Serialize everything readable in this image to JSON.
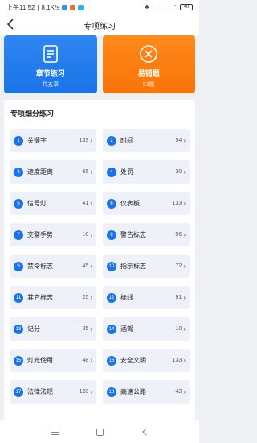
{
  "status_bar": {
    "time": "上午11:52",
    "speed": "8.1K/s",
    "battery": "40"
  },
  "header": {
    "title": "专项练习"
  },
  "cards": [
    {
      "title": "章节练习",
      "sub": "共五章",
      "color": "#1a74e8"
    },
    {
      "title": "易错题",
      "sub": "53题",
      "color": "#f97308"
    }
  ],
  "section": {
    "title": "专项细分练习"
  },
  "items": [
    {
      "num": "1",
      "label": "关键字",
      "count": "133"
    },
    {
      "num": "2",
      "label": "时间",
      "count": "54"
    },
    {
      "num": "3",
      "label": "速度距离",
      "count": "65"
    },
    {
      "num": "4",
      "label": "处罚",
      "count": "30"
    },
    {
      "num": "5",
      "label": "信号灯",
      "count": "41"
    },
    {
      "num": "6",
      "label": "仪表板",
      "count": "133"
    },
    {
      "num": "7",
      "label": "交警手势",
      "count": "10"
    },
    {
      "num": "8",
      "label": "警告标志",
      "count": "96"
    },
    {
      "num": "9",
      "label": "禁令标志",
      "count": "45"
    },
    {
      "num": "10",
      "label": "指示标志",
      "count": "72"
    },
    {
      "num": "11",
      "label": "其它标志",
      "count": "25"
    },
    {
      "num": "12",
      "label": "标线",
      "count": "91"
    },
    {
      "num": "13",
      "label": "记分",
      "count": "35"
    },
    {
      "num": "14",
      "label": "酒驾",
      "count": "10"
    },
    {
      "num": "15",
      "label": "灯光使用",
      "count": "48"
    },
    {
      "num": "16",
      "label": "安全文明",
      "count": "133"
    },
    {
      "num": "17",
      "label": "法律法规",
      "count": "128"
    },
    {
      "num": "18",
      "label": "高速公路",
      "count": "43"
    }
  ],
  "icons": {
    "back": "back-arrow-icon",
    "chapter": "document-icon",
    "mistakes": "wrong-mark-icon",
    "chevron": "chevron-right-icon"
  },
  "colors": {
    "accent_blue": "#1a74e8",
    "accent_orange": "#f97308",
    "item_bg": "#eef2f8"
  }
}
